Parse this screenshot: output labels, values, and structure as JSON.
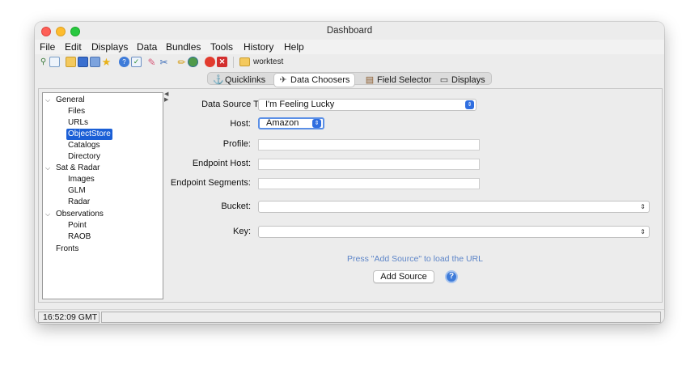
{
  "window": {
    "title": "Dashboard"
  },
  "menubar": {
    "items": [
      "File",
      "Edit",
      "Displays",
      "Data",
      "Bundles",
      "Tools",
      "History",
      "Help"
    ]
  },
  "toolbar": {
    "icons": [
      "wand-icon",
      "window-icon",
      "folder-open-icon",
      "save-icon",
      "copy-icon",
      "star-icon",
      "help-circle-icon",
      "check-icon",
      "eraser-icon",
      "scissors-icon",
      "pencil-icon",
      "globe-icon",
      "record-icon",
      "close-box-icon"
    ],
    "project_name": "worktest"
  },
  "tabs": [
    {
      "label": "Quicklinks",
      "icon": "link-icon",
      "active": false
    },
    {
      "label": "Data Choosers",
      "icon": "chooser-icon",
      "active": true
    },
    {
      "label": "Field Selector",
      "icon": "field-icon",
      "active": false
    },
    {
      "label": "Displays",
      "icon": "monitor-icon",
      "active": false
    }
  ],
  "tree": {
    "groups": [
      {
        "label": "General",
        "expanded": true,
        "children": [
          "Files",
          "URLs",
          "ObjectStore",
          "Catalogs",
          "Directory"
        ]
      },
      {
        "label": "Sat & Radar",
        "expanded": true,
        "children": [
          "Images",
          "GLM",
          "Radar"
        ]
      },
      {
        "label": "Observations",
        "expanded": true,
        "children": [
          "Point",
          "RAOB"
        ]
      },
      {
        "label": "Fronts",
        "expanded": false,
        "children": []
      }
    ],
    "selected": "ObjectStore"
  },
  "form": {
    "data_source_type": {
      "label": "Data Source Type:",
      "value": "I'm Feeling Lucky"
    },
    "host": {
      "label": "Host:",
      "value": "Amazon"
    },
    "profile": {
      "label": "Profile:",
      "value": ""
    },
    "endpoint_host": {
      "label": "Endpoint Host:",
      "value": ""
    },
    "endpoint_segments": {
      "label": "Endpoint Segments:",
      "value": ""
    },
    "bucket": {
      "label": "Bucket:",
      "value": ""
    },
    "key": {
      "label": "Key:",
      "value": ""
    },
    "hint": "Press \"Add Source\" to load the URL",
    "add_source_label": "Add Source",
    "help_label": "?"
  },
  "status": {
    "time": "16:52:09 GMT"
  },
  "colors": {
    "selection": "#1b5fd6",
    "hint": "#5d85c8",
    "accent_button": "#2f6ee0"
  }
}
